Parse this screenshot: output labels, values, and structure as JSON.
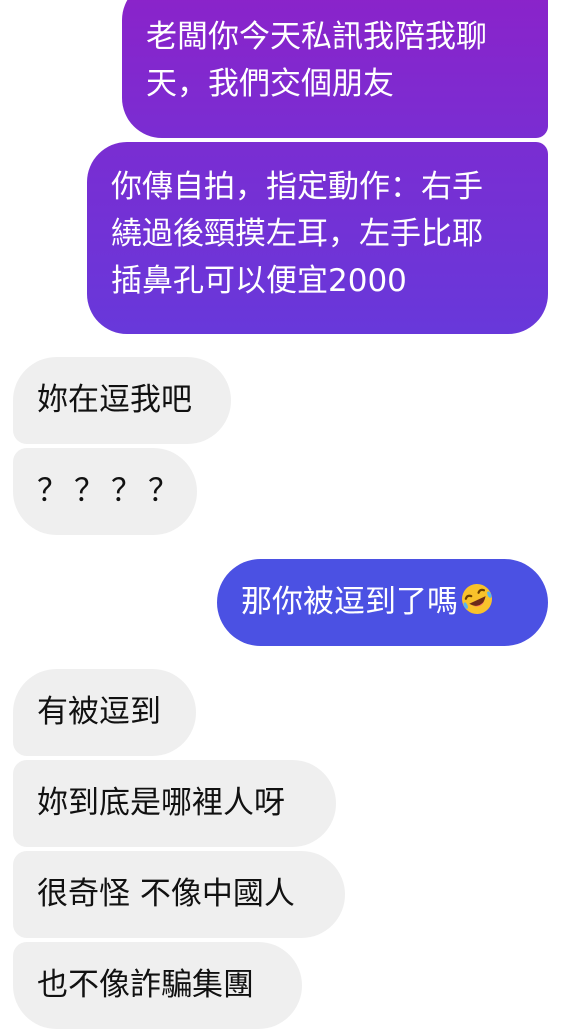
{
  "colors": {
    "outgoing_top": "#8c22c9",
    "outgoing_mid": "#7a2dd2",
    "outgoing_bottom": "#4b51e3",
    "incoming_bg": "#efefef",
    "incoming_text": "#111111",
    "outgoing_text": "#ffffff"
  },
  "messages": [
    {
      "direction": "outgoing",
      "lines": [
        "老闆你今天私訊我陪我聊",
        "天，我們交個朋友"
      ]
    },
    {
      "direction": "outgoing",
      "lines": [
        "你傳自拍，指定動作：右手",
        "繞過後頸摸左耳，左手比耶",
        "插鼻孔可以便宜2000"
      ]
    },
    {
      "direction": "incoming",
      "text": "妳在逗我吧"
    },
    {
      "direction": "incoming",
      "text": "？？？？"
    },
    {
      "direction": "outgoing",
      "text": "那你被逗到了嗎",
      "emoji": "rolling-on-floor-laughing-emoji"
    },
    {
      "direction": "incoming",
      "text": "有被逗到"
    },
    {
      "direction": "incoming",
      "text": "妳到底是哪裡人呀"
    },
    {
      "direction": "incoming",
      "text": "很奇怪 不像中國人"
    },
    {
      "direction": "incoming",
      "text": "也不像詐騙集團"
    }
  ]
}
